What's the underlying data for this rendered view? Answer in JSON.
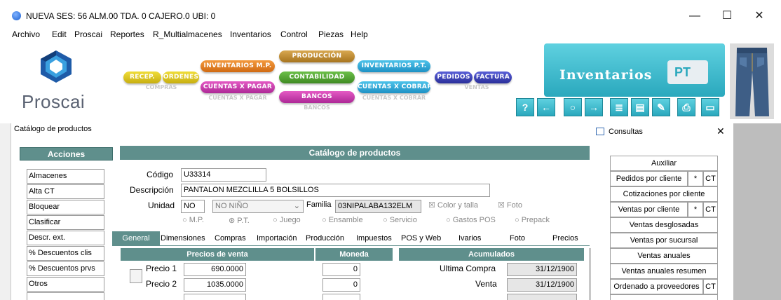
{
  "window": {
    "title": "NUEVA  SES: 56  ALM.00  TDA. 0  CAJERO.0  UBI: 0",
    "controls": {
      "minimize": "—",
      "maximize": "☐",
      "close": "✕"
    }
  },
  "menu": [
    "Archivo",
    "Edit",
    "Proscai",
    "Reportes",
    "R_Multialmacenes",
    "Inventarios",
    "Control",
    "Piezas",
    "Help"
  ],
  "brand": {
    "logo_text": "Proscai"
  },
  "module_buttons": {
    "recep": "RECEP.",
    "ordenes": "ORDENES",
    "inventarios_mp": "INVENTARIOS M.P.",
    "cuentas_pagar": "CUENTAS X PAGAR",
    "produccion": "PRODUCCIÓN",
    "contabilidad": "CONTABILIDAD",
    "bancos": "BANCOS",
    "inventarios_pt": "INVENTARIOS P.T.",
    "cuentas_cobrar": "CUENTAS X COBRAR",
    "pedidos": "PEDIDOS",
    "factura": "FACTURA",
    "refl_compras": "COMPRAS",
    "refl_cuentas_pagar": "CUENTAS X PAGAR",
    "refl_bancos": "BANCOS",
    "refl_cuentas_cobrar": "CUENTAS X COBRAR",
    "refl_ventas": "VENTAS"
  },
  "banner": {
    "title": "Inventarios",
    "tag": "PT"
  },
  "nav_icons": [
    "help-icon",
    "arrow-left-icon",
    "search-icon",
    "arrow-right-icon",
    "list-icon",
    "edit-doc-icon",
    "write-icon",
    "print-icon",
    "window-icon"
  ],
  "nav_glyphs": [
    "?",
    "←",
    "○",
    "→",
    "≣",
    "▤",
    "✎",
    "⎙",
    "▭"
  ],
  "catalog": {
    "window_title": "Catálogo de productos",
    "header": "Catálogo de productos",
    "actions_title": "Acciones",
    "actions": [
      "Almacenes",
      "Alta CT",
      "Bloquear",
      "Clasificar",
      "Descr. ext.",
      "% Descuentos clis",
      "% Descuentos prvs",
      "Otros"
    ],
    "codigo_label": "Código",
    "codigo_value": "U33314",
    "descripcion_label": "Descripción",
    "descripcion_value": "PANTALON MEZCLILLA 5 BOLSILLOS",
    "unidad_label": "Unidad",
    "unidad_value": "NO",
    "unidad_select": "NO  NIÑO",
    "familia_label": "Familia",
    "familia_value": "03NIPALABA132ELM",
    "color_talla": "Color y talla",
    "foto_check": "Foto",
    "radios": [
      "M.P.",
      "P.T.",
      "Juego",
      "Ensamble",
      "Servicio",
      "Gastos POS",
      "Prepack"
    ],
    "radio_selected": "P.T.",
    "tabs": [
      "General",
      "Dimensiones",
      "Compras",
      "Importación",
      "Producción",
      "Impuestos",
      "POS y Web",
      "Ivarios",
      "Foto",
      "Precios"
    ],
    "active_tab": "General",
    "precios_header": "Precios de venta",
    "moneda_header": "Moneda",
    "acumulados_header": "Acumulados",
    "precios": [
      {
        "label": "Precio 1",
        "value": "690.0000",
        "moneda": "0"
      },
      {
        "label": "Precio 2",
        "value": "1035.0000",
        "moneda": "0"
      }
    ],
    "acumulados": [
      {
        "label": "Ultima  Compra",
        "value": "31/12/1900"
      },
      {
        "label": "Venta",
        "value": "31/12/1900"
      }
    ]
  },
  "consultas": {
    "title": "Consultas",
    "close": "✕",
    "buttons": [
      {
        "label": "Auxiliar"
      },
      {
        "label": "Pedidos por cliente",
        "star": "*",
        "ct": "CT"
      },
      {
        "label": "Cotizaciones por cliente"
      },
      {
        "label": "Ventas por cliente",
        "star": "*",
        "ct": "CT"
      },
      {
        "label": "Ventas desglosadas"
      },
      {
        "label": "Ventas por sucursal"
      },
      {
        "label": "Ventas anuales"
      },
      {
        "label": "Ventas anuales resumen"
      },
      {
        "label": "Ordenado a proveedores",
        "ct": "CT"
      }
    ]
  },
  "colors": {
    "teal": "#5f8f8c",
    "banner": "#2aa8bd",
    "yellow": "#d8c21c",
    "orange": "#e07b22",
    "green": "#4f9a2f",
    "magenta": "#c038a8",
    "cyan": "#2aa8d8",
    "blue": "#3a3fb4"
  }
}
